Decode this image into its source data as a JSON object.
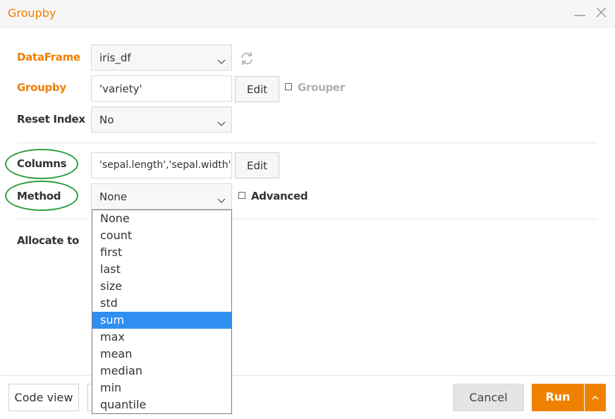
{
  "window": {
    "title": "Groupby"
  },
  "form": {
    "dataframe": {
      "label": "DataFrame",
      "value": "iris_df"
    },
    "groupby": {
      "label": "Groupby",
      "value": "'variety'",
      "edit_label": "Edit",
      "grouper_label": "Grouper"
    },
    "reset_index": {
      "label": "Reset Index",
      "value": "No"
    },
    "columns": {
      "label": "Columns",
      "value": "'sepal.length','sepal.width','",
      "edit_label": "Edit"
    },
    "method": {
      "label": "Method",
      "value": "None",
      "advanced_label": "Advanced"
    },
    "allocate_to": {
      "label": "Allocate to"
    }
  },
  "method_dropdown": {
    "options": [
      "None",
      "count",
      "first",
      "last",
      "size",
      "std",
      "sum",
      "max",
      "mean",
      "median",
      "min",
      "quantile"
    ],
    "highlighted": "sum"
  },
  "footer": {
    "code_view_label": "Code view",
    "cancel_label": "Cancel",
    "run_label": "Run"
  },
  "colors": {
    "accent": "#f08000",
    "highlight": "#2f8ff0",
    "annotation": "#2e9e3e"
  }
}
